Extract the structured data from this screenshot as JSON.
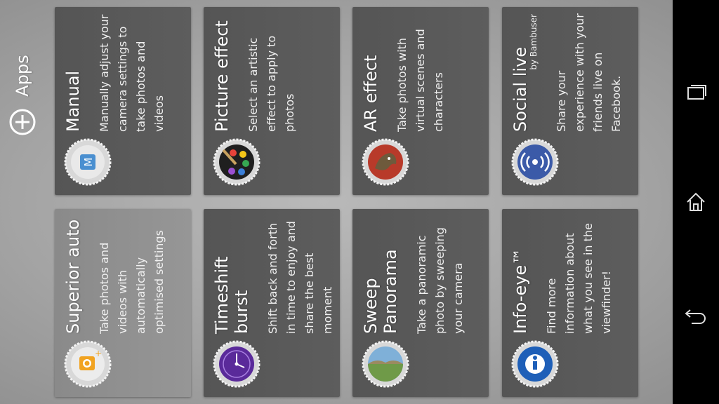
{
  "header": {
    "apps_label": "Apps"
  },
  "tiles": [
    {
      "title": "Manual",
      "subtitle": "",
      "description": "Manually adjust your camera settings to take photos and videos",
      "icon": "manual-icon"
    },
    {
      "title": "Superior auto",
      "subtitle": "",
      "description": "Take photos and videos with automatically optimised settings",
      "icon": "superior-auto-icon"
    },
    {
      "title": "Picture effect",
      "subtitle": "",
      "description": "Select an artistic effect to apply to photos",
      "icon": "picture-effect-icon"
    },
    {
      "title": "Timeshift burst",
      "subtitle": "",
      "description": "Shift back and forth in time to enjoy and share the best moment",
      "icon": "timeshift-burst-icon"
    },
    {
      "title": "AR effect",
      "subtitle": "",
      "description": "Take photos with virtual scenes and characters",
      "icon": "ar-effect-icon"
    },
    {
      "title": "Sweep Panorama",
      "subtitle": "",
      "description": "Take a panoramic photo by sweeping your camera",
      "icon": "sweep-panorama-icon"
    },
    {
      "title": "Social live",
      "subtitle": "by Bambuser",
      "description": "Share your experience with your friends live on Facebook.",
      "icon": "social-live-icon"
    },
    {
      "title": "Info-eye™",
      "subtitle": "",
      "description": "Find more information about what you see in the viewfinder!",
      "icon": "info-eye-icon"
    }
  ],
  "selected_tile": "Superior auto",
  "navbar": {
    "icons": [
      "recent-apps-icon",
      "home-icon",
      "back-icon"
    ]
  },
  "colors": {
    "tile_bg": "#5a5a5a",
    "tile_selected_bg": "#909090",
    "navbar_bg": "#000000",
    "text": "#ffffff"
  }
}
